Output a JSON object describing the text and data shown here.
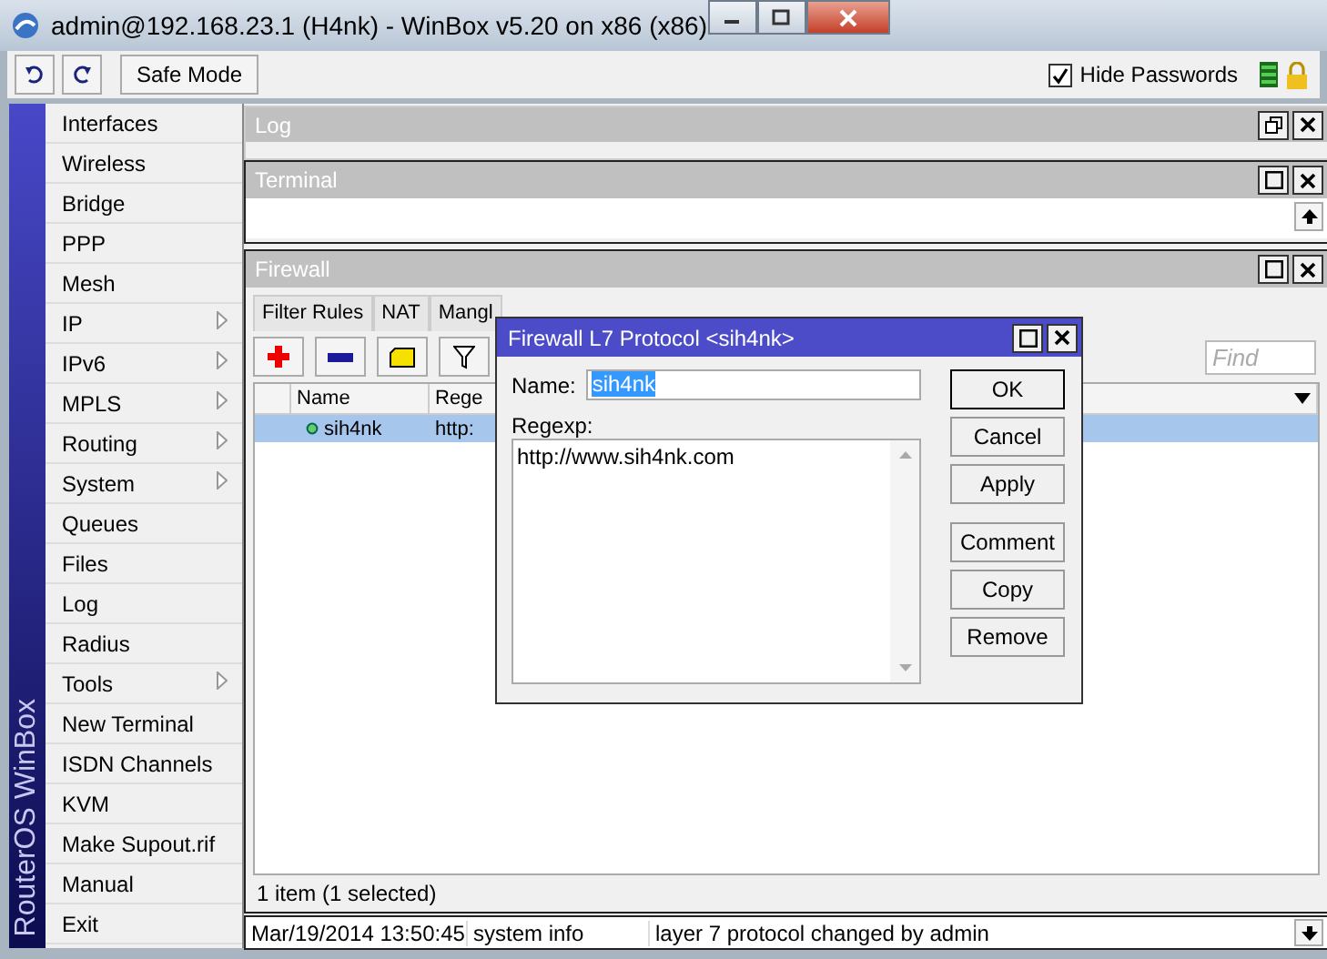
{
  "window": {
    "title": "admin@192.168.23.1 (H4nk) - WinBox v5.20 on x86 (x86)"
  },
  "toolbar": {
    "safe_mode": "Safe Mode",
    "hide_passwords": {
      "label": "Hide Passwords",
      "checked": true
    }
  },
  "sidebar": {
    "brand": "RouterOS WinBox",
    "items": [
      {
        "label": "Interfaces",
        "submenu": false
      },
      {
        "label": "Wireless",
        "submenu": false
      },
      {
        "label": "Bridge",
        "submenu": false
      },
      {
        "label": "PPP",
        "submenu": false
      },
      {
        "label": "Mesh",
        "submenu": false
      },
      {
        "label": "IP",
        "submenu": true
      },
      {
        "label": "IPv6",
        "submenu": true
      },
      {
        "label": "MPLS",
        "submenu": true
      },
      {
        "label": "Routing",
        "submenu": true
      },
      {
        "label": "System",
        "submenu": true
      },
      {
        "label": "Queues",
        "submenu": false
      },
      {
        "label": "Files",
        "submenu": false
      },
      {
        "label": "Log",
        "submenu": false
      },
      {
        "label": "Radius",
        "submenu": false
      },
      {
        "label": "Tools",
        "submenu": true
      },
      {
        "label": "New Terminal",
        "submenu": false
      },
      {
        "label": "ISDN Channels",
        "submenu": false
      },
      {
        "label": "KVM",
        "submenu": false
      },
      {
        "label": "Make Supout.rif",
        "submenu": false
      },
      {
        "label": "Manual",
        "submenu": false
      },
      {
        "label": "Exit",
        "submenu": false
      }
    ]
  },
  "log_window": {
    "title": "Log"
  },
  "terminal_window": {
    "title": "Terminal"
  },
  "firewall_window": {
    "title": "Firewall",
    "tabs": [
      {
        "label": "Filter Rules",
        "selected": false
      },
      {
        "label": "NAT",
        "selected": false
      },
      {
        "label": "Mangl",
        "selected": false
      }
    ],
    "find_placeholder": "Find",
    "columns": [
      "Name",
      "Rege"
    ],
    "rows": [
      {
        "name": "sih4nk",
        "regexp": "http:",
        "selected": true
      }
    ],
    "status": "1 item (1 selected)"
  },
  "dialog": {
    "title": "Firewall L7 Protocol <sih4nk>",
    "name_label": "Name:",
    "name_value": "sih4nk",
    "regexp_label": "Regexp:",
    "regexp_value": "http://www.sih4nk.com",
    "buttons": [
      "OK",
      "Cancel",
      "Apply",
      "Comment",
      "Copy",
      "Remove"
    ]
  },
  "log_line": {
    "time": "Mar/19/2014 13:50:45",
    "topic": "system info",
    "message": "layer 7 protocol changed by admin"
  }
}
